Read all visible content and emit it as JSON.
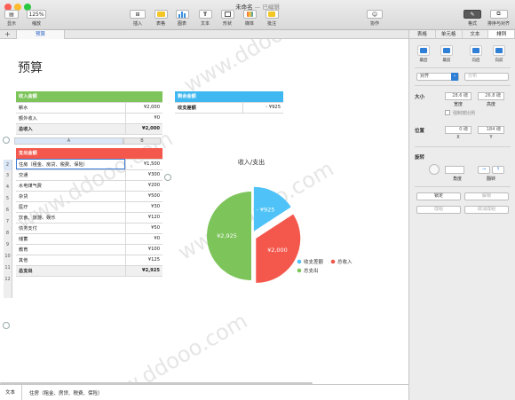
{
  "window": {
    "title": "未命名",
    "subtitle": "— 已编辑"
  },
  "toolbar": {
    "view": "显示",
    "zoom_value": "125%",
    "zoom": "缩放",
    "insert": "插入",
    "table": "表格",
    "chart": "图表",
    "text": "文本",
    "shape": "形状",
    "media": "媒体",
    "comment": "批注",
    "collaborate": "协作",
    "format": "格式",
    "arrange": "排序与对齐"
  },
  "sheet_tab": "预算",
  "add_sheet": "+",
  "doc_title": "预算",
  "income": {
    "header": "收入金额",
    "rows": [
      {
        "label": "薪水",
        "value": "¥2,000"
      },
      {
        "label": "额外收入",
        "value": "¥0"
      }
    ],
    "total": {
      "label": "总收入",
      "value": "¥2,000"
    }
  },
  "balance": {
    "header": "剩余金额",
    "rows": [
      {
        "label": "收支差额",
        "value": "- ¥925"
      }
    ]
  },
  "columns": [
    "A",
    "B"
  ],
  "expense": {
    "header": "支出金额",
    "rows": [
      {
        "num": "2",
        "label": "住房（租金、房贷、税费、保险）",
        "value": "¥1,500"
      },
      {
        "num": "3",
        "label": "交通",
        "value": "¥300"
      },
      {
        "num": "4",
        "label": "水电煤气费",
        "value": "¥200"
      },
      {
        "num": "5",
        "label": "杂货",
        "value": "¥500"
      },
      {
        "num": "6",
        "label": "医疗",
        "value": "¥30"
      },
      {
        "num": "7",
        "label": "饮食、旅游、娱乐",
        "value": "¥120"
      },
      {
        "num": "8",
        "label": "债务支付",
        "value": "¥50"
      },
      {
        "num": "9",
        "label": "储蓄",
        "value": "¥0"
      },
      {
        "num": "10",
        "label": "教育",
        "value": "¥100"
      },
      {
        "num": "11",
        "label": "其他",
        "value": "¥125"
      }
    ],
    "total": {
      "num": "12",
      "label": "总支出",
      "value": "¥2,925"
    }
  },
  "chart_data": {
    "type": "pie",
    "title": "收入/支出",
    "slices": [
      {
        "name": "收支差额",
        "value": 925,
        "label": "- ¥925",
        "color": "#4fc3f7"
      },
      {
        "name": "总收入",
        "value": 2000,
        "label": "¥2,000",
        "color": "#f4574b"
      },
      {
        "name": "总支出",
        "value": 2925,
        "label": "¥2,925",
        "color": "#7dc45b"
      }
    ],
    "legend_position": "bottom-right"
  },
  "statusbar": {
    "label": "文本",
    "content": "住房（租金、房贷、税费、保险）"
  },
  "panel": {
    "tabs": [
      "表格",
      "单元格",
      "文本",
      "排列"
    ],
    "layer_buttons": [
      "最后",
      "最前",
      "向后",
      "向前"
    ],
    "align_label": "对齐",
    "align_value": "",
    "distribute_value": "分布",
    "size_label": "大小",
    "width_value": "28.6 磅",
    "width": "宽度",
    "height_value": "26.8 磅",
    "height": "高度",
    "constrain": "强制按比例",
    "position_label": "位置",
    "x_value": "0 磅",
    "x": "X",
    "y_value": "184 磅",
    "y": "Y",
    "rotate_label": "旋转",
    "angle": "角度",
    "flip": "翻转",
    "lock": "锁定",
    "unlock": "解锁",
    "group": "成组",
    "ungroup": "取消成组"
  }
}
